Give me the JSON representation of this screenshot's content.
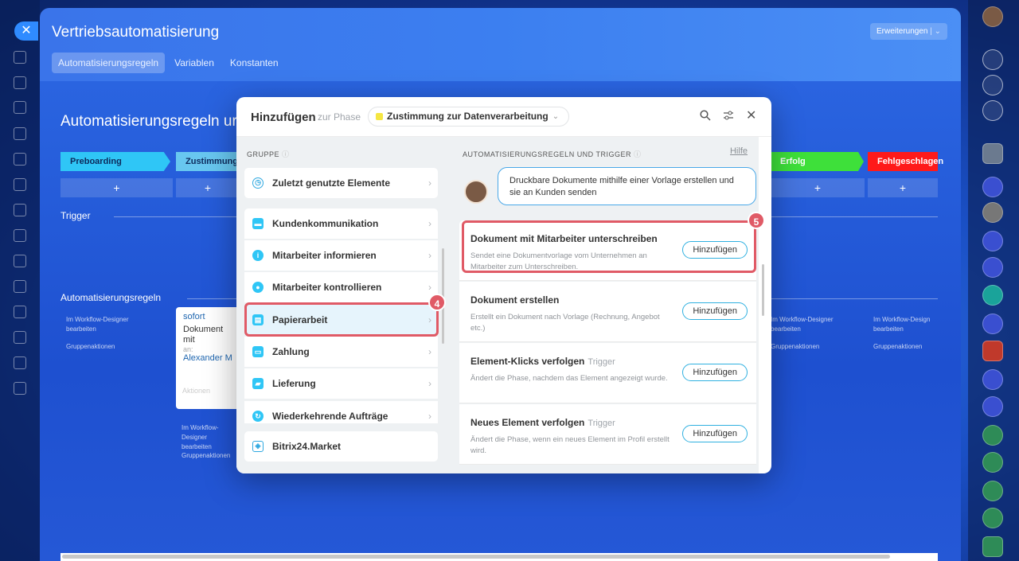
{
  "page": {
    "title": "Vertriebsautomatisierung",
    "tabs": [
      "Automatisierungsregeln",
      "Variablen",
      "Konstanten"
    ],
    "extensions_label": "Erweiterungen",
    "heading": "Automatisierungsregeln ur",
    "stages": [
      {
        "label": "Preboarding",
        "color": "#2fc6f6"
      },
      {
        "label": "Zustimmung",
        "color": "#68c7f0"
      },
      {
        "label": "Erfolg",
        "color": "#3ee03a"
      },
      {
        "label": "Fehlgeschlagen",
        "color": "#ff1a1a"
      }
    ],
    "plus": "+",
    "trigger_label": "Trigger",
    "rules_label": "Automatisierungsregeln",
    "designer_link": "Im Workflow-Designer bearbeiten",
    "group_actions": "Gruppenaktionen",
    "designer_link_short": "Im Workflow-Design bearbeiten",
    "card": {
      "when": "sofort",
      "text": "Dokument mit Mitarbeiter unterschreiben",
      "to_label": "an:",
      "to": "Alexander Me",
      "actions": "Aktionen"
    }
  },
  "modal": {
    "title": "Hinzufügen",
    "subtitle": "zur Phase",
    "phase": "Zustimmung zur Datenverarbeitung",
    "group_header": "GRUPPE",
    "groups": [
      {
        "label": "Zuletzt genutzte Elemente",
        "icon": "clock-icon"
      },
      {
        "label": "Kundenkommunikation",
        "icon": "chat-icon"
      },
      {
        "label": "Mitarbeiter informieren",
        "icon": "info-icon"
      },
      {
        "label": "Mitarbeiter kontrollieren",
        "icon": "users-icon"
      },
      {
        "label": "Papierarbeit",
        "icon": "document-icon"
      },
      {
        "label": "Zahlung",
        "icon": "wallet-icon"
      },
      {
        "label": "Lieferung",
        "icon": "truck-icon"
      },
      {
        "label": "Wiederkehrende Aufträge",
        "icon": "repeat-icon"
      }
    ],
    "market": "Bitrix24.Market",
    "rules_header": "AUTOMATISIERUNGSREGELN UND TRIGGER",
    "help": "Hilfe",
    "bubble": "Druckbare Dokumente mithilfe einer Vorlage erstellen und sie an Kunden senden",
    "rules": [
      {
        "title": "Dokument mit Mitarbeiter unterschreiben",
        "tag": "",
        "desc": "Sendet eine Dokumentvorlage vom Unternehmen an Mitarbeiter zum Unterschreiben.",
        "button": "Hinzufügen"
      },
      {
        "title": "Dokument erstellen",
        "tag": "",
        "desc": "Erstellt ein Dokument nach Vorlage (Rechnung, Angebot etc.)",
        "button": "Hinzufügen"
      },
      {
        "title": "Element-Klicks verfolgen",
        "tag": "Trigger",
        "desc": "Ändert die Phase, nachdem das Element angezeigt wurde.",
        "button": "Hinzufügen"
      },
      {
        "title": "Neues Element verfolgen",
        "tag": "Trigger",
        "desc": "Ändert die Phase, wenn ein neues Element im Profil erstellt wird.",
        "button": "Hinzufügen"
      }
    ],
    "badges": [
      "4",
      "5"
    ]
  }
}
